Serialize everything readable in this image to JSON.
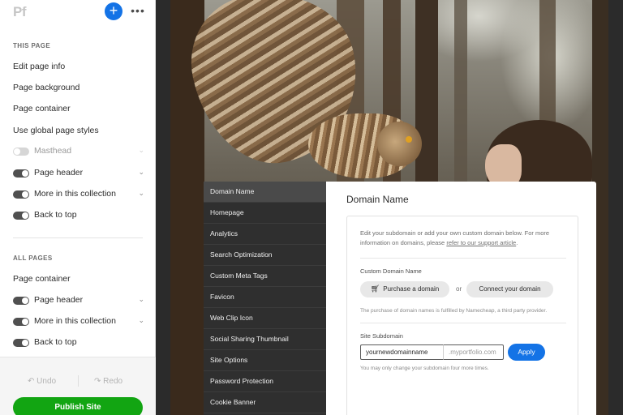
{
  "app": {
    "logo": "Pf"
  },
  "header": {
    "add_symbol": "+",
    "more_symbol": "•••"
  },
  "this_page": {
    "label": "THIS PAGE",
    "links": [
      "Edit page info",
      "Page background",
      "Page container",
      "Use global page styles"
    ],
    "toggles": [
      {
        "label": "Masthead",
        "on": false,
        "disabled": true
      },
      {
        "label": "Page header",
        "on": true
      },
      {
        "label": "More in this collection",
        "on": true
      },
      {
        "label": "Back to top",
        "on": true
      }
    ]
  },
  "all_pages": {
    "label": "ALL PAGES",
    "links": [
      "Page container"
    ],
    "toggles": [
      {
        "label": "Page header",
        "on": true
      },
      {
        "label": "More in this collection",
        "on": true
      },
      {
        "label": "Back to top",
        "on": true
      }
    ]
  },
  "bottom": {
    "undo": "Undo",
    "redo": "Redo",
    "publish": "Publish Site"
  },
  "settings_nav": {
    "items": [
      "Domain Name",
      "Homepage",
      "Analytics",
      "Search Optimization",
      "Custom Meta Tags",
      "Favicon",
      "Web Clip Icon",
      "Social Sharing Thumbnail",
      "Site Options",
      "Password Protection",
      "Cookie Banner"
    ],
    "active": "Domain Name"
  },
  "domain": {
    "title": "Domain Name",
    "description": "Edit your subdomain or add your own custom domain below. For more information on domains, please",
    "support_link": "refer to our support article",
    "custom_label": "Custom Domain Name",
    "purchase_button": "Purchase a domain",
    "or": "or",
    "connect_button": "Connect your domain",
    "namecheap_note": "The purchase of domain names is fulfilled by Namecheap, a third party provider.",
    "subdomain_label": "Site Subdomain",
    "subdomain_value": "yournewdomainname",
    "subdomain_suffix": ".myportfolio.com",
    "apply_button": "Apply",
    "subdomain_note": "You may only change your subdomain four more times."
  },
  "colors": {
    "accent": "#1473e6",
    "publish": "#12a512",
    "nav_bg": "#2f2f2f"
  }
}
